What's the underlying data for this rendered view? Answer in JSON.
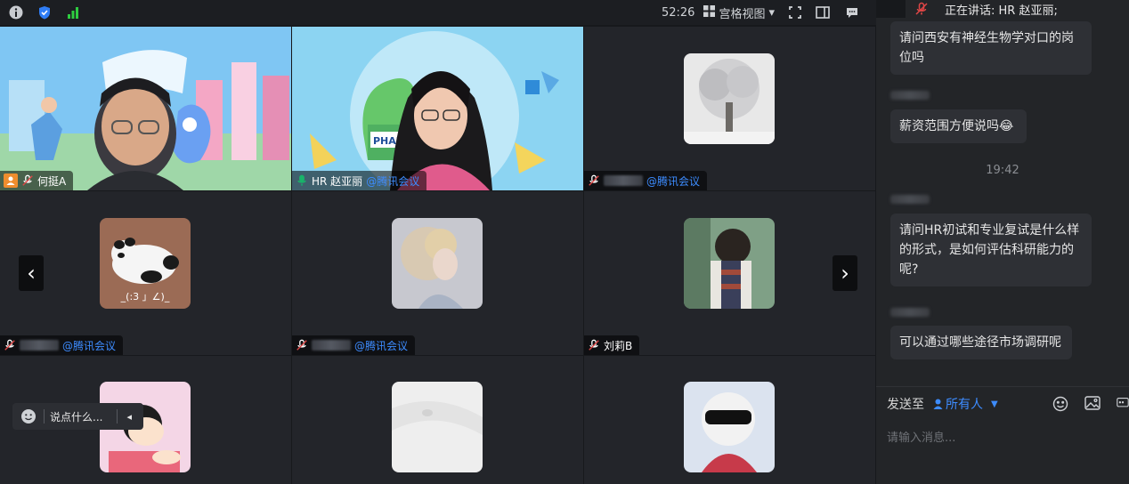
{
  "topbar": {
    "timer": "52:26",
    "view_label": "宫格视图",
    "view_caret": "▾"
  },
  "speaking": {
    "label": "正在讲话:  HR 赵亚丽;"
  },
  "tiles": [
    {
      "name": "何挺A",
      "suffix": ""
    },
    {
      "name": "HR 赵亚丽",
      "suffix": "@腾讯会议"
    },
    {
      "name": "",
      "suffix": "@腾讯会议"
    },
    {
      "name": "",
      "suffix": "@腾讯会议"
    },
    {
      "name": "",
      "suffix": "@腾讯会议"
    },
    {
      "name": "刘莉B",
      "suffix": ""
    }
  ],
  "tile_text": {
    "panda_caption": "_(:3 」∠)_",
    "banner_brand": "PHAR"
  },
  "say_bar": {
    "placeholder": "说点什么...",
    "caret": "◂"
  },
  "arrows": {
    "left": "‹",
    "right": "›"
  },
  "chat": {
    "messages": [
      "请问西安有神经生物学对口的岗位吗",
      "薪资范围方便说吗😂",
      "请问HR初试和专业复试是什么样的形式，是如何评估科研能力的呢?",
      "可以通过哪些途径市场调研呢"
    ],
    "time_divider": "19:42",
    "send_to_label": "发送至",
    "send_to_target": "所有人",
    "send_to_caret": "▼",
    "input_placeholder": "请输入消息..."
  },
  "colors": {
    "accent": "#3d8cff",
    "active_tile_border": "#19b46a",
    "signal": "#2ecc40",
    "mic_red": "#e04646"
  }
}
